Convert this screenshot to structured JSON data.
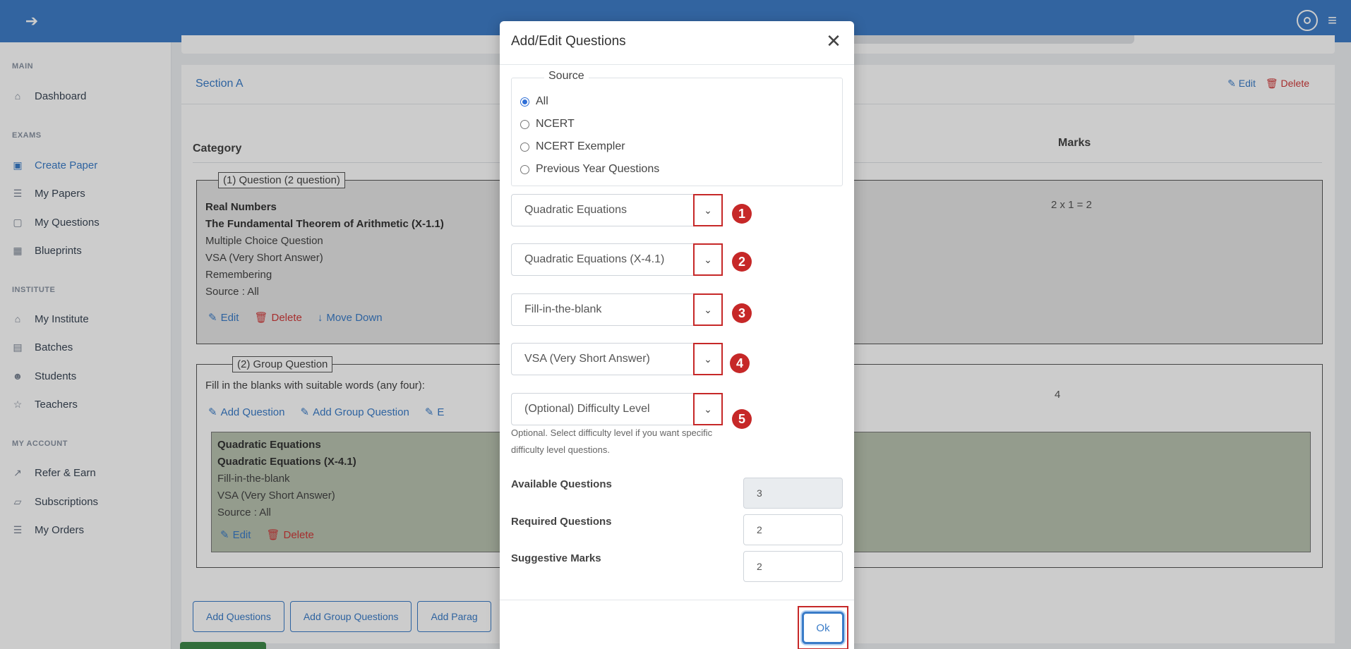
{
  "app": {
    "back_icon": "arrow-left-icon",
    "header_icons": [
      "target-icon",
      "hamburger-menu-icon"
    ]
  },
  "sidebar": {
    "sections": [
      {
        "title": "MAIN",
        "items": [
          {
            "label": "Dashboard",
            "icon": "home-icon"
          }
        ]
      },
      {
        "title": "EXAMS",
        "items": [
          {
            "label": "Create Paper",
            "icon": "file-plus-icon",
            "active": true
          },
          {
            "label": "My Papers",
            "icon": "layers-icon"
          },
          {
            "label": "My Questions",
            "icon": "archive-icon"
          },
          {
            "label": "Blueprints",
            "icon": "calendar-icon"
          }
        ]
      },
      {
        "title": "INSTITUTE",
        "items": [
          {
            "label": "My Institute",
            "icon": "home-icon"
          },
          {
            "label": "Batches",
            "icon": "server-icon"
          },
          {
            "label": "Students",
            "icon": "users-icon"
          },
          {
            "label": "Teachers",
            "icon": "star-icon"
          }
        ]
      },
      {
        "title": "MY ACCOUNT",
        "items": [
          {
            "label": "Refer & Earn",
            "icon": "trending-up-icon"
          },
          {
            "label": "Subscriptions",
            "icon": "box-icon"
          },
          {
            "label": "My Orders",
            "icon": "layers-icon"
          }
        ]
      }
    ]
  },
  "section": {
    "title": "Section A",
    "edit_label": "Edit",
    "delete_label": "Delete",
    "col_category": "Category",
    "col_marks": "Marks",
    "q1": {
      "legend": "(1) Question (2 question)",
      "chapter": "Real Numbers",
      "topic": "The Fundamental Theorem of Arithmetic (X-1.1)",
      "type": "Multiple Choice Question",
      "length": "VSA (Very Short Answer)",
      "level": "Remembering",
      "source": "Source : All",
      "edit": "Edit",
      "delete": "Delete",
      "move_down": "Move Down",
      "marks": "2 x 1 = 2"
    },
    "q2": {
      "legend": "(2) Group Question",
      "instruction": "Fill in the blanks with suitable words (any four):",
      "add_question": "Add Question",
      "add_group_question": "Add Group Question",
      "truncated_link": "E",
      "marks": "4",
      "inner": {
        "chapter": "Quadratic Equations",
        "topic": "Quadratic Equations (X-4.1)",
        "type": "Fill-in-the-blank",
        "length": "VSA (Very Short Answer)",
        "source": "Source : All",
        "edit": "Edit",
        "delete": "Delete"
      }
    },
    "bottom_buttons": [
      "Add Questions",
      "Add Group Questions",
      "Add Parag"
    ]
  },
  "modal": {
    "title": "Add/Edit Questions",
    "close_icon": "close-x-icon",
    "source_legend": "Source",
    "source_options": [
      "All",
      "NCERT",
      "NCERT Exempler",
      "Previous Year Questions"
    ],
    "source_selected": 0,
    "selects": [
      {
        "value": "Quadratic Equations",
        "badge": "1"
      },
      {
        "value": "Quadratic Equations (X-4.1)",
        "badge": "2"
      },
      {
        "value": "Fill-in-the-blank",
        "badge": "3"
      },
      {
        "value": "VSA (Very Short Answer)",
        "badge": "4"
      },
      {
        "value": "(Optional) Difficulty Level",
        "badge": "5"
      }
    ],
    "difficulty_hint": "Optional. Select difficulty level if you want specific difficulty level questions.",
    "available_label": "Available Questions",
    "available_value": "3",
    "required_label": "Required Questions",
    "required_value": "2",
    "marks_label": "Suggestive Marks",
    "marks_value": "2",
    "ok_label": "Ok"
  },
  "colors": {
    "accent": "#3a7cc8",
    "header": "#3f7ec8",
    "danger": "#d03a3a",
    "annotation_red": "#c62828"
  }
}
